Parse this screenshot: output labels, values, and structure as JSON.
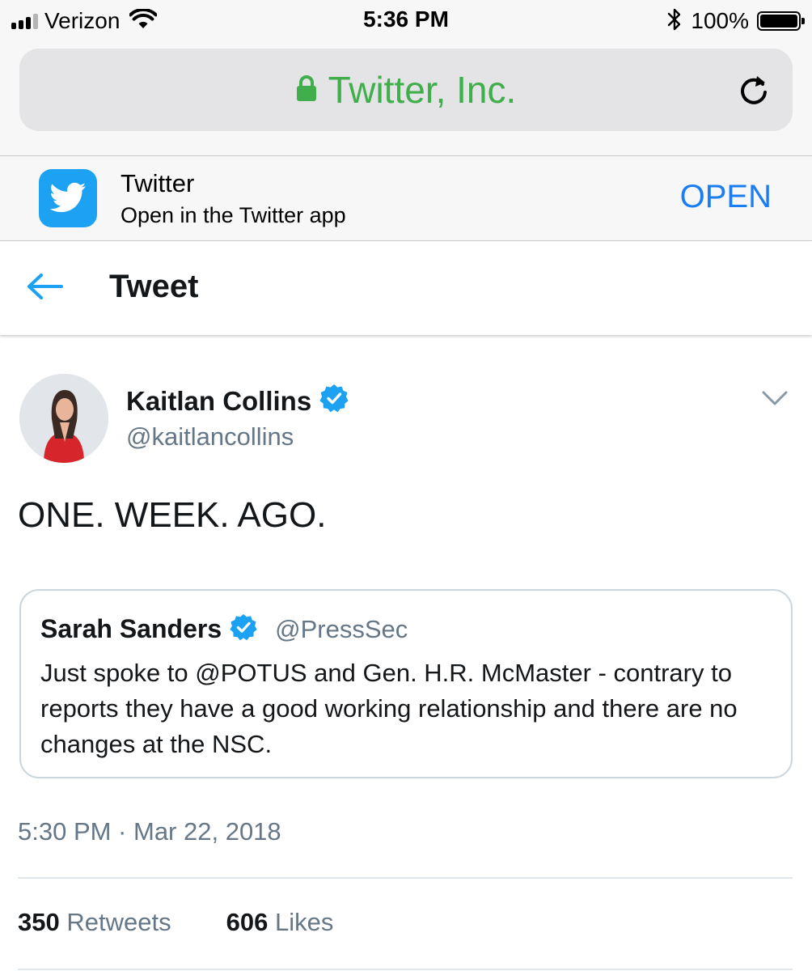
{
  "status_bar": {
    "carrier": "Verizon",
    "time": "5:36 PM",
    "battery": "100%",
    "battery_level": 1.0
  },
  "browser": {
    "url_title": "Twitter, Inc."
  },
  "app_banner": {
    "app_name": "Twitter",
    "subtitle": "Open in the Twitter app",
    "open_label": "OPEN"
  },
  "header": {
    "title": "Tweet"
  },
  "tweet": {
    "author_name": "Kaitlan Collins",
    "author_handle": "@kaitlancollins",
    "text": "ONE. WEEK. AGO.",
    "quoted": {
      "author_name": "Sarah Sanders",
      "author_handle": "@PressSec",
      "text": "Just spoke to @POTUS and Gen. H.R. McMaster - contrary to reports they have a good working relationship and there are no changes at the NSC."
    },
    "timestamp": "5:30 PM · Mar 22, 2018",
    "retweets_count": "350",
    "retweets_label": "Retweets",
    "likes_count": "606",
    "likes_label": "Likes"
  },
  "icons": {
    "secure": "lock-icon",
    "reload": "reload-icon",
    "app": "twitter-bird-icon",
    "back": "back-arrow-icon",
    "verified": "verified-badge-icon",
    "more": "chevron-down-icon"
  },
  "colors": {
    "url_green": "#3fae4b",
    "twitter_blue": "#1da1f2",
    "open_blue": "#1a7ef2",
    "secondary_text": "#657786"
  }
}
